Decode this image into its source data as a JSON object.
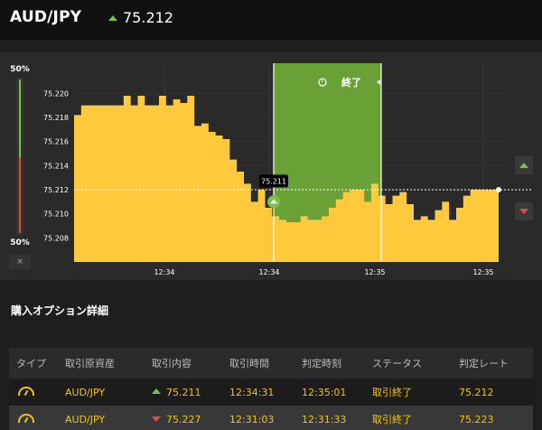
{
  "header": {
    "pair": "AUD/JPY",
    "rate": "75.212",
    "rate_direction": "up"
  },
  "chart": {
    "gauge_top": "50%",
    "gauge_bottom": "50%",
    "gauge_close": "×",
    "y_ticks": [
      "75.220",
      "75.218",
      "75.216",
      "75.214",
      "75.212",
      "75.210",
      "75.208"
    ],
    "x_ticks": [
      "12:34",
      "12:34",
      "12:35",
      "12:35"
    ],
    "entry_label": "75.211",
    "window_label": "終了",
    "colors": {
      "area": "#ffc93c",
      "window": "#6aa136",
      "up": "#7cc242",
      "down": "#e04b3a"
    }
  },
  "chart_data": {
    "type": "area",
    "ylim": [
      75.206,
      75.2225
    ],
    "y_ticks": [
      75.208,
      75.21,
      75.212,
      75.214,
      75.216,
      75.218,
      75.22
    ],
    "x": [
      0,
      1,
      2,
      3,
      4,
      5,
      6,
      7,
      8,
      9,
      10,
      11,
      12,
      13,
      14,
      15,
      16,
      17,
      18,
      19,
      20,
      21,
      22,
      23,
      24,
      25,
      26,
      27,
      28,
      29,
      30,
      31,
      32,
      33,
      34,
      35,
      36,
      37,
      38,
      39,
      40,
      41,
      42,
      43,
      44,
      45,
      46,
      47,
      48,
      49,
      50,
      51,
      52,
      53,
      54,
      55,
      56,
      57,
      58,
      59,
      60
    ],
    "values": [
      75.2182,
      75.219,
      75.219,
      75.219,
      75.219,
      75.219,
      75.219,
      75.2198,
      75.219,
      75.2198,
      75.219,
      75.219,
      75.2198,
      75.219,
      75.2195,
      75.2192,
      75.2198,
      75.2173,
      75.2175,
      75.2168,
      75.2165,
      75.2162,
      75.2145,
      75.2135,
      75.2125,
      75.211,
      75.212,
      75.2105,
      75.2098,
      75.2095,
      75.2093,
      75.2093,
      75.2098,
      75.2095,
      75.2095,
      75.2098,
      75.2105,
      75.2112,
      75.2118,
      75.212,
      75.212,
      75.211,
      75.2125,
      75.2115,
      75.2108,
      75.2115,
      75.2118,
      75.2108,
      75.2095,
      75.2098,
      75.2095,
      75.2103,
      75.211,
      75.2095,
      75.2105,
      75.2115,
      75.212,
      75.212,
      75.212,
      75.212,
      75.212
    ],
    "current_rate": 75.212,
    "entry_rate": 75.211,
    "x_tick_labels": [
      "12:34",
      "12:34",
      "12:35",
      "12:35"
    ],
    "grid": true
  },
  "section": {
    "title": "購入オプション詳細"
  },
  "table": {
    "headers": [
      "タイプ",
      "取引原資産",
      "取引内容",
      "取引時間",
      "判定時刻",
      "ステータス",
      "判定レート"
    ],
    "rows": [
      {
        "asset": "AUD/JPY",
        "direction": "up",
        "rate": "75.211",
        "time": "12:34:31",
        "judge_time": "12:35:01",
        "status": "取引終了",
        "judge_rate": "75.212"
      },
      {
        "asset": "AUD/JPY",
        "direction": "down",
        "rate": "75.227",
        "time": "12:31:03",
        "judge_time": "12:31:33",
        "status": "取引終了",
        "judge_rate": "75.223"
      }
    ]
  }
}
